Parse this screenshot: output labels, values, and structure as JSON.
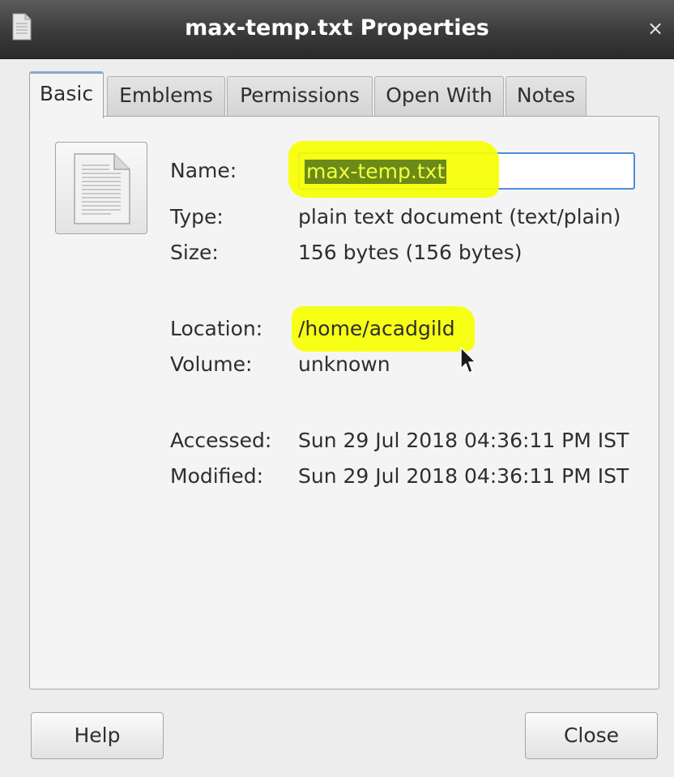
{
  "window": {
    "title": "max-temp.txt Properties",
    "close_glyph": "×"
  },
  "tabs": [
    {
      "label": "Basic",
      "active": true
    },
    {
      "label": "Emblems",
      "active": false
    },
    {
      "label": "Permissions",
      "active": false
    },
    {
      "label": "Open With",
      "active": false
    },
    {
      "label": "Notes",
      "active": false
    }
  ],
  "basic": {
    "icon": "text-document-icon",
    "name_label": "Name:",
    "name_value": "max-temp.txt",
    "type_label": "Type:",
    "type_value": "plain text document (text/plain)",
    "size_label": "Size:",
    "size_value": "156 bytes (156 bytes)",
    "location_label": "Location:",
    "location_value": "/home/acadgild",
    "volume_label": "Volume:",
    "volume_value": "unknown",
    "accessed_label": "Accessed:",
    "accessed_value": "Sun 29 Jul 2018 04:36:11 PM IST",
    "modified_label": "Modified:",
    "modified_value": "Sun 29 Jul 2018 04:36:11 PM IST"
  },
  "buttons": {
    "help": "Help",
    "close": "Close"
  },
  "colors": {
    "highlight_marker": "#f6ff00",
    "titlebar": "#3b3b3b",
    "focus_border": "#4a90d9"
  }
}
